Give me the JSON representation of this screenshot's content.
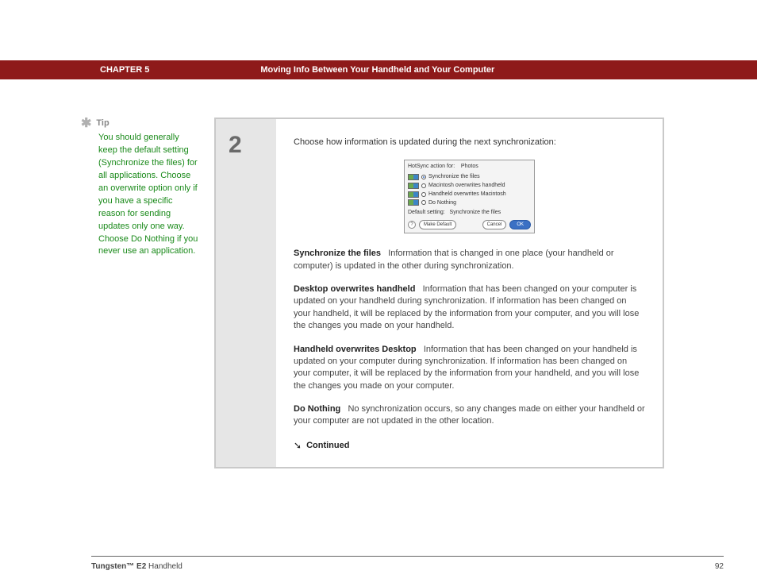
{
  "header": {
    "chapter": "CHAPTER 5",
    "title": "Moving Info Between Your Handheld and Your Computer"
  },
  "tip": {
    "label": "Tip",
    "body": "You should generally keep the default setting (Synchronize the files) for all applications. Choose an overwrite option only if you have a specific reason for sending updates only one way. Choose Do Nothing if you never use an application."
  },
  "step": {
    "number": "2"
  },
  "instruction": "Choose how information is updated during the next synchronization:",
  "dialog": {
    "title_prefix": "HotSync action for:",
    "title_item": "Photos",
    "options": [
      {
        "label": "Synchronize the files",
        "selected": true
      },
      {
        "label": "Macintosh overwrites handheld",
        "selected": false
      },
      {
        "label": "Handheld overwrites Macintosh",
        "selected": false
      },
      {
        "label": "Do Nothing",
        "selected": false
      }
    ],
    "default_prefix": "Default setting:",
    "default_value": "Synchronize the files",
    "help_glyph": "?",
    "buttons": {
      "make_default": "Make Default",
      "cancel": "Cancel",
      "ok": "OK"
    }
  },
  "definitions": [
    {
      "term": "Synchronize the files",
      "body": "Information that is changed in one place (your handheld or computer) is updated in the other during synchronization."
    },
    {
      "term": "Desktop overwrites handheld",
      "body": "Information that has been changed on your computer is updated on your handheld during synchronization. If information has been changed on your handheld, it will be replaced by the information from your computer, and you will lose the changes you made on your handheld."
    },
    {
      "term": "Handheld overwrites Desktop",
      "body": "Information that has been changed on your handheld is updated on your computer during synchronization. If information has been changed on your computer, it will be replaced by the information from your handheld, and you will lose the changes you made on your computer."
    },
    {
      "term": "Do Nothing",
      "body": "No synchronization occurs, so any changes made on either your handheld or your computer are not updated in the other location."
    }
  ],
  "continued": "Continued",
  "footer": {
    "product_bold": "Tungsten™ E2",
    "product_rest": " Handheld",
    "page": "92"
  }
}
